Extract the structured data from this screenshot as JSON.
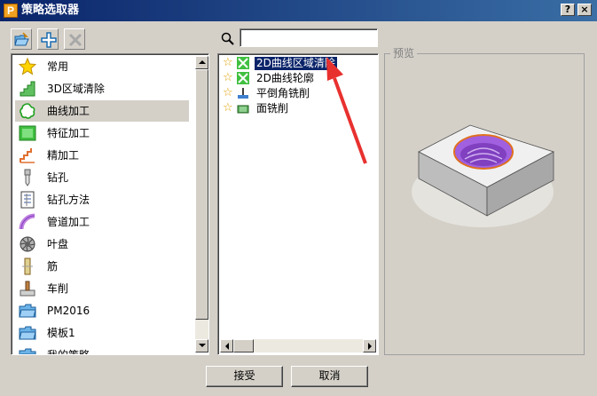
{
  "window": {
    "title": "策略选取器",
    "app_icon_letter": "P",
    "help_button": "?",
    "close_button": "×"
  },
  "toolbar": {
    "buttons": [
      {
        "name": "open-folder-icon"
      },
      {
        "name": "add-icon"
      },
      {
        "name": "delete-icon"
      }
    ]
  },
  "categories": [
    {
      "label": "常用",
      "icon": "star-icon"
    },
    {
      "label": "3D区域清除",
      "icon": "3d-area-clear-icon"
    },
    {
      "label": "曲线加工",
      "icon": "curve-machining-icon"
    },
    {
      "label": "特征加工",
      "icon": "feature-machining-icon"
    },
    {
      "label": "精加工",
      "icon": "finishing-icon"
    },
    {
      "label": "钻孔",
      "icon": "drilling-icon"
    },
    {
      "label": "钻孔方法",
      "icon": "drilling-method-icon"
    },
    {
      "label": "管道加工",
      "icon": "pipe-machining-icon"
    },
    {
      "label": "叶盘",
      "icon": "blisk-icon"
    },
    {
      "label": "筋",
      "icon": "rib-icon"
    },
    {
      "label": "车削",
      "icon": "turning-icon"
    },
    {
      "label": "PM2016",
      "icon": "folder-icon"
    },
    {
      "label": "模板1",
      "icon": "folder-icon"
    },
    {
      "label": "我的策略",
      "icon": "folder-icon"
    }
  ],
  "selected_category": "曲线加工",
  "search": {
    "value": "",
    "placeholder": ""
  },
  "strategies": [
    {
      "label": "2D曲线区域清除",
      "selected": true
    },
    {
      "label": "2D曲线轮廓",
      "selected": false
    },
    {
      "label": "平倒角铣削",
      "selected": false
    },
    {
      "label": "面铣削",
      "selected": false
    }
  ],
  "preview": {
    "label": "预览"
  },
  "buttons": {
    "accept": "接受",
    "cancel": "取消"
  },
  "colors": {
    "title_bar": "#0a246a",
    "selection": "#0a246a",
    "annotation_arrow": "#e8312f",
    "part_purple": "#a060e0"
  }
}
